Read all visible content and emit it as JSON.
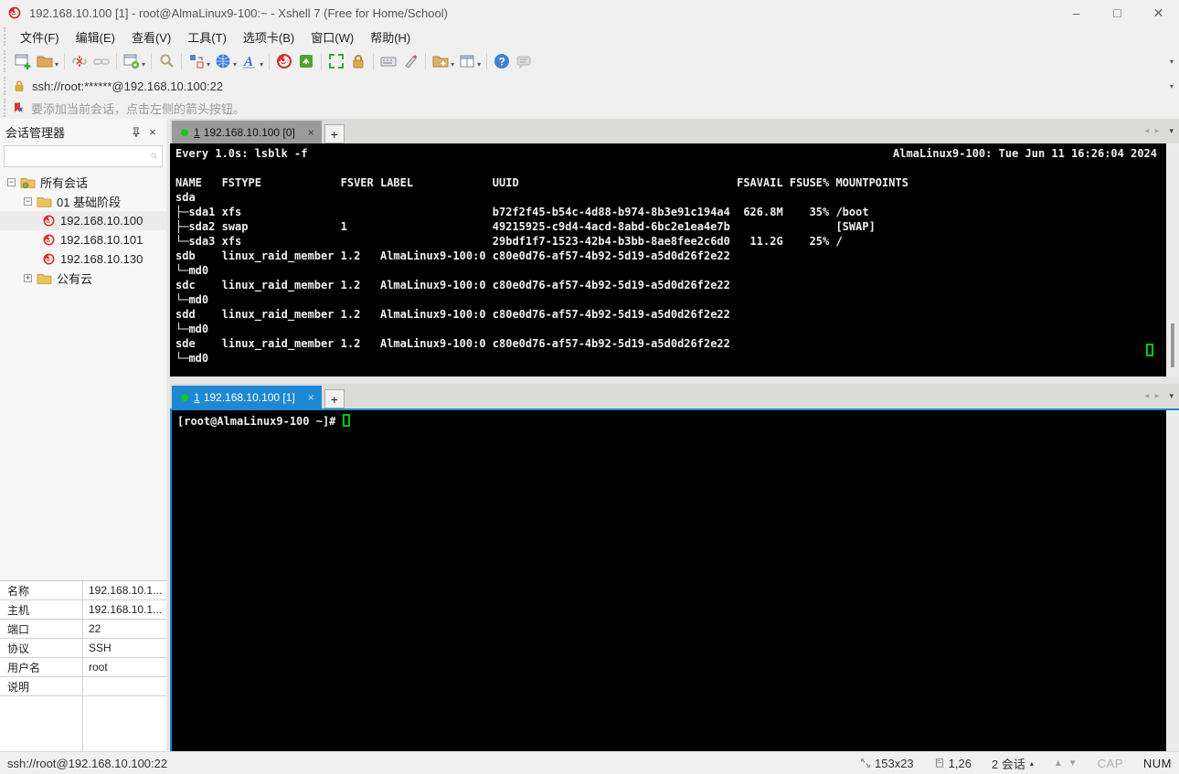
{
  "window": {
    "title": "192.168.10.100 [1] - root@AlmaLinux9-100:~ - Xshell 7 (Free for Home/School)",
    "controls": {
      "minimize": "–",
      "maximize": "□",
      "close": "✕"
    }
  },
  "menu": {
    "items": [
      "文件(F)",
      "编辑(E)",
      "查看(V)",
      "工具(T)",
      "选项卡(B)",
      "窗口(W)",
      "帮助(H)"
    ]
  },
  "toolbar": {
    "icons": [
      "new-session",
      "open-sessions",
      "disconnect",
      "reconnect",
      "session-properties",
      "find",
      "transfer",
      "web-tools",
      "font",
      "xshell",
      "xftp",
      "fullscreen",
      "lock-screen",
      "virtual-keyboard",
      "highlight-pen",
      "new-session-folder",
      "layout",
      "help",
      "feedback"
    ]
  },
  "addressbar": {
    "url": "ssh://root:******@192.168.10.100:22"
  },
  "infobar": {
    "text": "要添加当前会话，点击左侧的箭头按钮。"
  },
  "sidebar": {
    "title": "会话管理器",
    "search_placeholder": "",
    "tree": [
      {
        "label": "所有会话"
      },
      {
        "label": "01 基础阶段"
      },
      {
        "label": "192.168.10.100"
      },
      {
        "label": "192.168.10.101"
      },
      {
        "label": "192.168.10.130"
      },
      {
        "label": "公有云"
      }
    ],
    "props": [
      {
        "label": "名称",
        "value": "192.168.10.1..."
      },
      {
        "label": "主机",
        "value": "192.168.10.1..."
      },
      {
        "label": "端口",
        "value": "22"
      },
      {
        "label": "协议",
        "value": "SSH"
      },
      {
        "label": "用户名",
        "value": "root"
      },
      {
        "label": "说明",
        "value": ""
      }
    ]
  },
  "tabs": {
    "tab1": {
      "num": "1",
      "label": "192.168.10.100 [0]",
      "close": "×"
    },
    "tab2": {
      "num": "1",
      "label": "192.168.10.100 [1]",
      "close": "×"
    },
    "new_tab": "+"
  },
  "terminal1": {
    "header_left": "Every 1.0s: lsblk -f",
    "header_right": "AlmaLinux9-100: Tue Jun 11 16:26:04 2024",
    "lines": [
      "",
      "NAME   FSTYPE            FSVER LABEL            UUID                                 FSAVAIL FSUSE% MOUNTPOINTS",
      "sda",
      "├─sda1 xfs                                      b72f2f45-b54c-4d88-b974-8b3e91c194a4  626.8M    35% /boot",
      "├─sda2 swap              1                      49215925-c9d4-4acd-8abd-6bc2e1ea4e7b                [SWAP]",
      "└─sda3 xfs                                      29bdf1f7-1523-42b4-b3bb-8ae8fee2c6d0   11.2G    25% /",
      "sdb    linux_raid_member 1.2   AlmaLinux9-100:0 c80e0d76-af57-4b92-5d19-a5d0d26f2e22",
      "└─md0",
      "sdc    linux_raid_member 1.2   AlmaLinux9-100:0 c80e0d76-af57-4b92-5d19-a5d0d26f2e22",
      "└─md0",
      "sdd    linux_raid_member 1.2   AlmaLinux9-100:0 c80e0d76-af57-4b92-5d19-a5d0d26f2e22",
      "└─md0",
      "sde    linux_raid_member 1.2   AlmaLinux9-100:0 c80e0d76-af57-4b92-5d19-a5d0d26f2e22",
      "└─md0"
    ]
  },
  "terminal2": {
    "prompt": "[root@AlmaLinux9-100 ~]# "
  },
  "statusbar": {
    "url": "ssh://root@192.168.10.100:22",
    "size": "153x23",
    "cursor_pos": "1,26",
    "sessions": "2 会话",
    "cap": "CAP",
    "num": "NUM"
  },
  "colors": {
    "accent_blue": "#1e88d2",
    "terminal_green": "#00c800",
    "tab_green_dot": "#1cc41c",
    "xshell_red": "#d23030"
  }
}
